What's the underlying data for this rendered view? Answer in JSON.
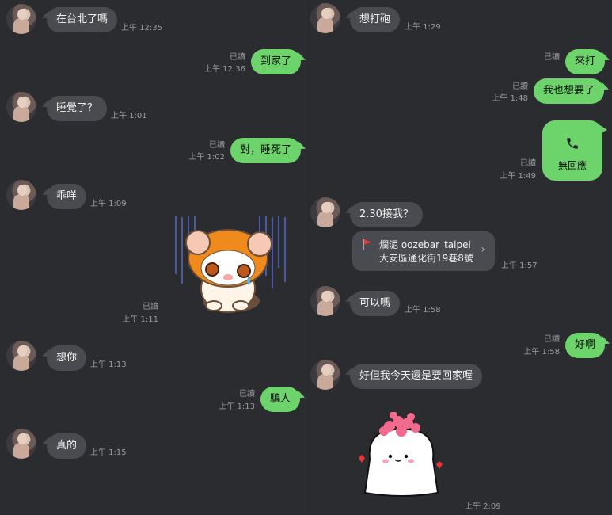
{
  "left_messages": [
    {
      "text": "在台北了嗎",
      "time": "上午 12:35"
    },
    {
      "text": "到家了",
      "read": "已讀",
      "time": "上午 12:36"
    },
    {
      "text": "睡覺了？",
      "time": "上午 1:01"
    },
    {
      "text": "對，睡死了",
      "read": "已讀",
      "time": "上午 1:02"
    },
    {
      "text": "乖咩",
      "time": "上午 1:09"
    },
    {
      "read": "已讀",
      "time": "上午 1:11"
    },
    {
      "text": "想你",
      "time": "上午 1:13"
    },
    {
      "text": "騙人",
      "read": "已讀",
      "time": "上午 1:13"
    },
    {
      "text": "真的",
      "time": "上午 1:15"
    }
  ],
  "right_messages": [
    {
      "text": "想打砲",
      "time": "上午 1:29"
    },
    {
      "text": "來打",
      "read": "已讀"
    },
    {
      "text": "我也想要了",
      "read": "已讀",
      "time": "上午 1:48"
    },
    {
      "call_label": "無回應",
      "read": "已讀",
      "time": "上午 1:49"
    },
    {
      "text": "2.30接我？"
    },
    {
      "location_name": "爛泥 oozebar_taipei",
      "location_addr": "大安區通化街19巷8號",
      "time": "上午 1:57"
    },
    {
      "text": "可以嗎",
      "time": "上午 1:58"
    },
    {
      "text": "好啊",
      "read": "已讀",
      "time": "上午 1:58"
    },
    {
      "text": "好但我今天還是要回家喔"
    },
    {
      "time": "上午 2:09"
    }
  ],
  "colors": {
    "background": "#2b2c30",
    "incoming": "#4a4b50",
    "outgoing": "#6cd46b",
    "meta": "#9b9ca1"
  }
}
